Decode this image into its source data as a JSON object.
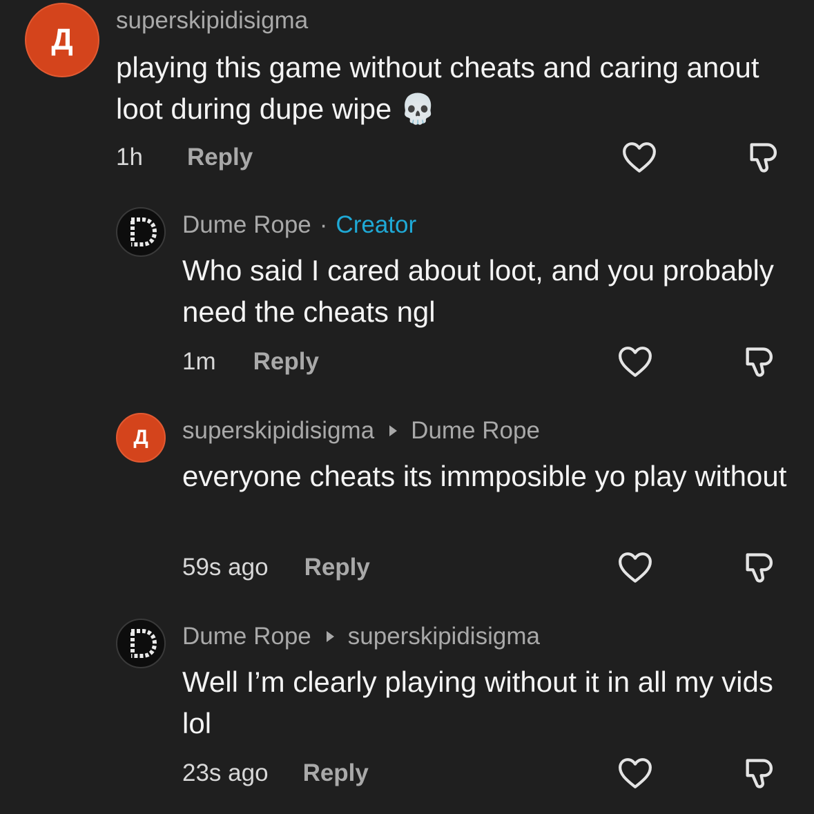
{
  "comments": [
    {
      "avatar_letter": "Д",
      "author": "superskipidisigma",
      "text": "playing this game without cheats and caring anout loot during dupe wipe 💀",
      "time": "1h",
      "reply_label": "Reply"
    },
    {
      "avatar_letter": "D",
      "author": "Dume Rope",
      "separator": "·",
      "badge": "Creator",
      "text": "Who said I cared about loot, and you probably need the cheats ngl",
      "time": "1m",
      "reply_label": "Reply"
    },
    {
      "avatar_letter": "Д",
      "author": "superskipidisigma",
      "reply_to": "Dume Rope",
      "text": "everyone cheats its immposible yo play without",
      "time": "59s ago",
      "reply_label": "Reply"
    },
    {
      "avatar_letter": "D",
      "author": "Dume Rope",
      "reply_to": "superskipidisigma",
      "text": "Well I’m clearly playing without it in all my vids lol",
      "time": "23s ago",
      "reply_label": "Reply"
    }
  ],
  "icons": {
    "like": "heart-icon",
    "dislike": "thumbs-down-icon",
    "reply_arrow": "caret-right-icon"
  },
  "colors": {
    "background": "#1f1f1f",
    "creator_badge": "#1fa9d6",
    "avatar_orange": "#d4441c"
  }
}
